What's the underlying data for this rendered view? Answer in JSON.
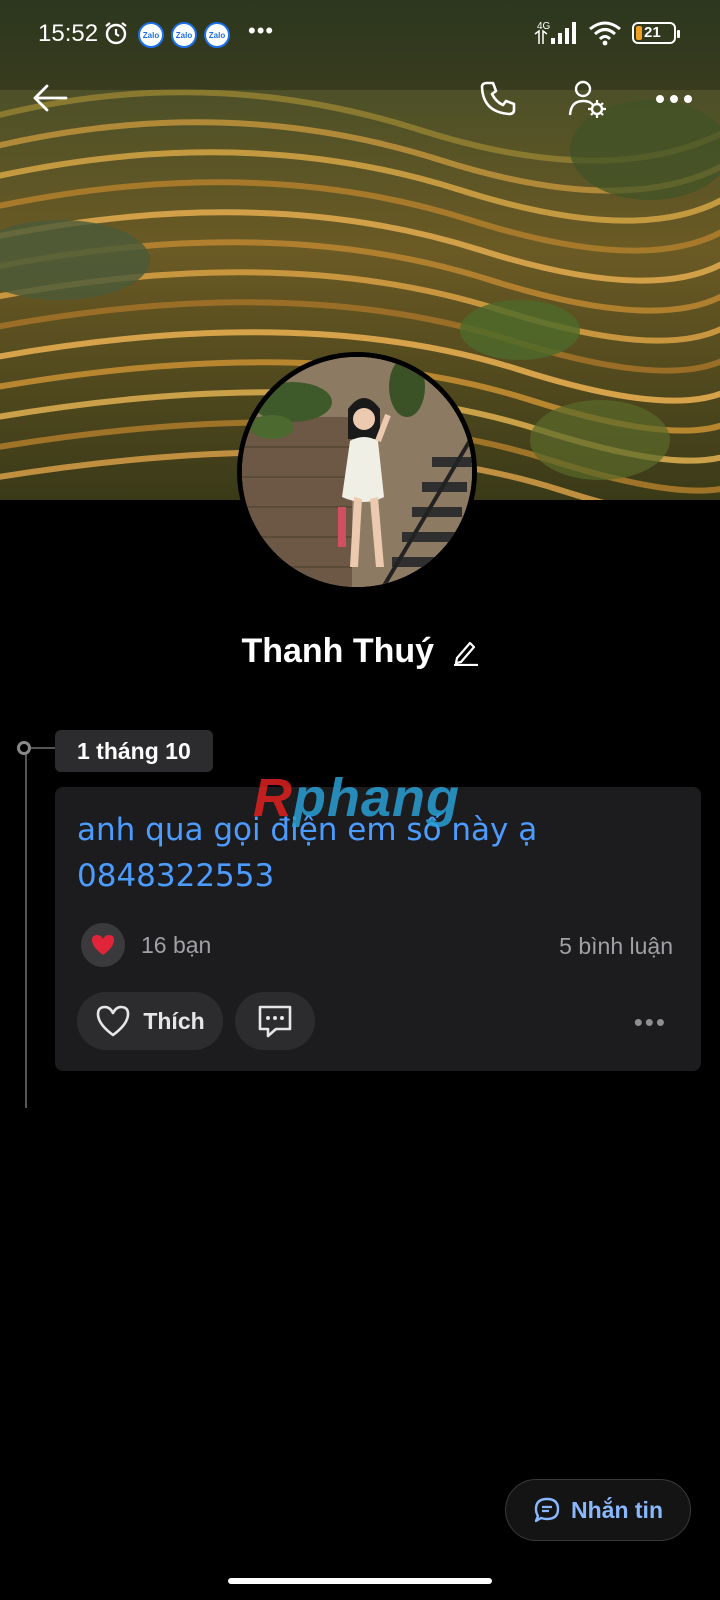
{
  "status_bar": {
    "time": "15:52",
    "notification_apps": [
      "Zalo",
      "Zalo",
      "Zalo"
    ],
    "overflow": "•••",
    "network": "4G",
    "battery_level": "21"
  },
  "icons": {
    "back": "arrow-left-icon",
    "call": "phone-icon",
    "settings": "user-settings-icon",
    "more": "more-horizontal-icon",
    "edit": "pencil-icon",
    "heart": "heart-icon",
    "like": "heart-outline-icon",
    "comment": "comment-icon",
    "message": "chat-bubble-icon"
  },
  "profile": {
    "name": "Thanh Thuý"
  },
  "timeline": {
    "date_label": "1 tháng 10"
  },
  "post": {
    "text_line1": "anh qua gọi điện em số này ạ",
    "text_line2": "0848322553",
    "likes_label": "16 bạn",
    "comments_label": "5 bình luận",
    "like_button": "Thích",
    "more": "•••"
  },
  "watermark": {
    "part1": "R",
    "part2": "phang"
  },
  "actions": {
    "message_button": "Nhắn tin"
  },
  "colors": {
    "background": "#000000",
    "card": "#1c1c1e",
    "link_text": "#4c9cff",
    "heart": "#e0253a",
    "message_accent": "#8ab8ff"
  }
}
